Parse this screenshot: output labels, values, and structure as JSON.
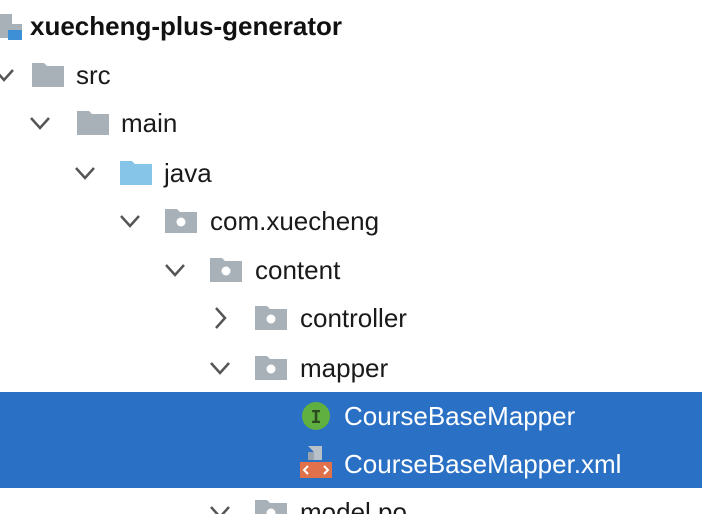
{
  "project_tree": {
    "root": {
      "label": "xuecheng-plus-generator",
      "icon": "module-icon"
    },
    "items": [
      {
        "label": "src",
        "icon": "folder-icon",
        "state": "expanded"
      },
      {
        "label": "main",
        "icon": "folder-icon",
        "state": "expanded"
      },
      {
        "label": "java",
        "icon": "source-root-folder-icon",
        "state": "expanded"
      },
      {
        "label": "com.xuecheng",
        "icon": "package-icon",
        "state": "expanded"
      },
      {
        "label": "content",
        "icon": "package-icon",
        "state": "expanded"
      },
      {
        "label": "controller",
        "icon": "package-icon",
        "state": "collapsed"
      },
      {
        "label": "mapper",
        "icon": "package-icon",
        "state": "expanded"
      },
      {
        "label": "CourseBaseMapper",
        "icon": "java-interface-icon",
        "badge": "I",
        "selected": true
      },
      {
        "label": "CourseBaseMapper.xml",
        "icon": "xml-file-icon",
        "selected": true
      },
      {
        "label": "model.po",
        "icon": "package-icon",
        "state": "expanded"
      }
    ]
  },
  "colors": {
    "selection": "#2a70c4",
    "folder": "#a8b0b8",
    "source_root_folder": "#86c5e8",
    "interface_icon": "#5fb040",
    "xml_icon": "#e0714a"
  }
}
